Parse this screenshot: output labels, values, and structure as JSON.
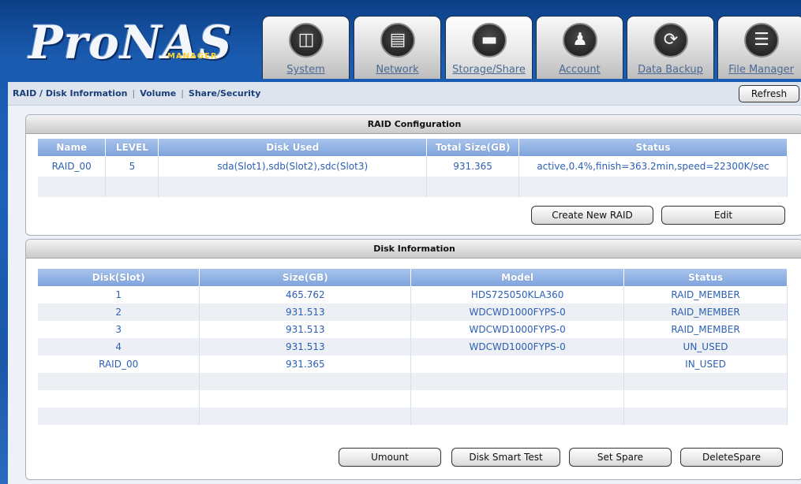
{
  "app": {
    "logo_text": "ProNAS",
    "logo_sub": "MANAGER"
  },
  "tabs": [
    {
      "label": "System",
      "icon": "monitor-icon"
    },
    {
      "label": "Network",
      "icon": "network-icon"
    },
    {
      "label": "Storage/Share",
      "icon": "drive-icon"
    },
    {
      "label": "Account",
      "icon": "users-icon"
    },
    {
      "label": "Data Backup",
      "icon": "backup-icon"
    },
    {
      "label": "File Manager",
      "icon": "document-icon"
    }
  ],
  "active_tab": "Storage/Share",
  "subnav": {
    "raid": "RAID / Disk Information",
    "volume": "Volume",
    "share": "Share/Security",
    "refresh": "Refresh"
  },
  "raid_panel": {
    "title": "RAID Configuration",
    "columns": [
      "Name",
      "LEVEL",
      "Disk Used",
      "Total Size(GB)",
      "Status"
    ],
    "rows": [
      [
        "RAID_00",
        "5",
        "sda(Slot1),sdb(Slot2),sdc(Slot3)",
        "931.365",
        "active,0.4%,finish=363.2min,speed=22300K/sec"
      ],
      [
        "",
        "",
        "",
        "",
        ""
      ]
    ],
    "buttons": {
      "create": "Create New RAID",
      "edit": "Edit"
    }
  },
  "disk_panel": {
    "title": "Disk Information",
    "columns": [
      "Disk(Slot)",
      "Size(GB)",
      "Model",
      "Status"
    ],
    "rows": [
      [
        "1",
        "465.762",
        "HDS725050KLA360",
        "RAID_MEMBER"
      ],
      [
        "2",
        "931.513",
        "WDCWD1000FYPS-0",
        "RAID_MEMBER"
      ],
      [
        "3",
        "931.513",
        "WDCWD1000FYPS-0",
        "RAID_MEMBER"
      ],
      [
        "4",
        "931.513",
        "WDCWD1000FYPS-0",
        "UN_USED"
      ],
      [
        "RAID_00",
        "931.365",
        "",
        "IN_USED"
      ],
      [
        "",
        "",
        "",
        ""
      ],
      [
        "",
        "",
        "",
        ""
      ],
      [
        "",
        "",
        "",
        ""
      ]
    ],
    "buttons": {
      "umount": "Umount",
      "smart": "Disk Smart Test",
      "set_spare": "Set Spare",
      "delete_spare": "DeleteSpare"
    }
  },
  "colors": {
    "header_blue": "#1d61b8",
    "table_header": "#7ea3dc",
    "cell_text": "#2c5fb5",
    "logo_accent": "#ffd02a"
  }
}
